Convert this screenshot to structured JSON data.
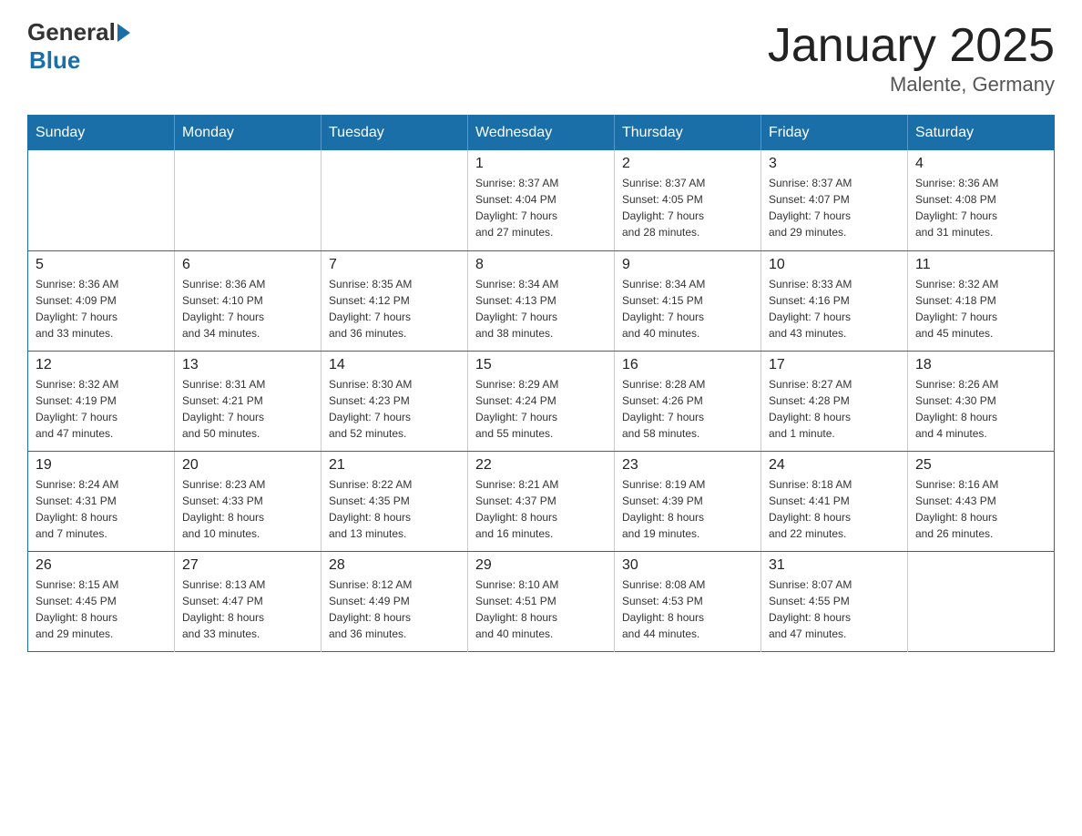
{
  "logo": {
    "general": "General",
    "blue": "Blue"
  },
  "title": "January 2025",
  "subtitle": "Malente, Germany",
  "weekdays": [
    "Sunday",
    "Monday",
    "Tuesday",
    "Wednesday",
    "Thursday",
    "Friday",
    "Saturday"
  ],
  "weeks": [
    [
      {
        "day": "",
        "info": ""
      },
      {
        "day": "",
        "info": ""
      },
      {
        "day": "",
        "info": ""
      },
      {
        "day": "1",
        "info": "Sunrise: 8:37 AM\nSunset: 4:04 PM\nDaylight: 7 hours\nand 27 minutes."
      },
      {
        "day": "2",
        "info": "Sunrise: 8:37 AM\nSunset: 4:05 PM\nDaylight: 7 hours\nand 28 minutes."
      },
      {
        "day": "3",
        "info": "Sunrise: 8:37 AM\nSunset: 4:07 PM\nDaylight: 7 hours\nand 29 minutes."
      },
      {
        "day": "4",
        "info": "Sunrise: 8:36 AM\nSunset: 4:08 PM\nDaylight: 7 hours\nand 31 minutes."
      }
    ],
    [
      {
        "day": "5",
        "info": "Sunrise: 8:36 AM\nSunset: 4:09 PM\nDaylight: 7 hours\nand 33 minutes."
      },
      {
        "day": "6",
        "info": "Sunrise: 8:36 AM\nSunset: 4:10 PM\nDaylight: 7 hours\nand 34 minutes."
      },
      {
        "day": "7",
        "info": "Sunrise: 8:35 AM\nSunset: 4:12 PM\nDaylight: 7 hours\nand 36 minutes."
      },
      {
        "day": "8",
        "info": "Sunrise: 8:34 AM\nSunset: 4:13 PM\nDaylight: 7 hours\nand 38 minutes."
      },
      {
        "day": "9",
        "info": "Sunrise: 8:34 AM\nSunset: 4:15 PM\nDaylight: 7 hours\nand 40 minutes."
      },
      {
        "day": "10",
        "info": "Sunrise: 8:33 AM\nSunset: 4:16 PM\nDaylight: 7 hours\nand 43 minutes."
      },
      {
        "day": "11",
        "info": "Sunrise: 8:32 AM\nSunset: 4:18 PM\nDaylight: 7 hours\nand 45 minutes."
      }
    ],
    [
      {
        "day": "12",
        "info": "Sunrise: 8:32 AM\nSunset: 4:19 PM\nDaylight: 7 hours\nand 47 minutes."
      },
      {
        "day": "13",
        "info": "Sunrise: 8:31 AM\nSunset: 4:21 PM\nDaylight: 7 hours\nand 50 minutes."
      },
      {
        "day": "14",
        "info": "Sunrise: 8:30 AM\nSunset: 4:23 PM\nDaylight: 7 hours\nand 52 minutes."
      },
      {
        "day": "15",
        "info": "Sunrise: 8:29 AM\nSunset: 4:24 PM\nDaylight: 7 hours\nand 55 minutes."
      },
      {
        "day": "16",
        "info": "Sunrise: 8:28 AM\nSunset: 4:26 PM\nDaylight: 7 hours\nand 58 minutes."
      },
      {
        "day": "17",
        "info": "Sunrise: 8:27 AM\nSunset: 4:28 PM\nDaylight: 8 hours\nand 1 minute."
      },
      {
        "day": "18",
        "info": "Sunrise: 8:26 AM\nSunset: 4:30 PM\nDaylight: 8 hours\nand 4 minutes."
      }
    ],
    [
      {
        "day": "19",
        "info": "Sunrise: 8:24 AM\nSunset: 4:31 PM\nDaylight: 8 hours\nand 7 minutes."
      },
      {
        "day": "20",
        "info": "Sunrise: 8:23 AM\nSunset: 4:33 PM\nDaylight: 8 hours\nand 10 minutes."
      },
      {
        "day": "21",
        "info": "Sunrise: 8:22 AM\nSunset: 4:35 PM\nDaylight: 8 hours\nand 13 minutes."
      },
      {
        "day": "22",
        "info": "Sunrise: 8:21 AM\nSunset: 4:37 PM\nDaylight: 8 hours\nand 16 minutes."
      },
      {
        "day": "23",
        "info": "Sunrise: 8:19 AM\nSunset: 4:39 PM\nDaylight: 8 hours\nand 19 minutes."
      },
      {
        "day": "24",
        "info": "Sunrise: 8:18 AM\nSunset: 4:41 PM\nDaylight: 8 hours\nand 22 minutes."
      },
      {
        "day": "25",
        "info": "Sunrise: 8:16 AM\nSunset: 4:43 PM\nDaylight: 8 hours\nand 26 minutes."
      }
    ],
    [
      {
        "day": "26",
        "info": "Sunrise: 8:15 AM\nSunset: 4:45 PM\nDaylight: 8 hours\nand 29 minutes."
      },
      {
        "day": "27",
        "info": "Sunrise: 8:13 AM\nSunset: 4:47 PM\nDaylight: 8 hours\nand 33 minutes."
      },
      {
        "day": "28",
        "info": "Sunrise: 8:12 AM\nSunset: 4:49 PM\nDaylight: 8 hours\nand 36 minutes."
      },
      {
        "day": "29",
        "info": "Sunrise: 8:10 AM\nSunset: 4:51 PM\nDaylight: 8 hours\nand 40 minutes."
      },
      {
        "day": "30",
        "info": "Sunrise: 8:08 AM\nSunset: 4:53 PM\nDaylight: 8 hours\nand 44 minutes."
      },
      {
        "day": "31",
        "info": "Sunrise: 8:07 AM\nSunset: 4:55 PM\nDaylight: 8 hours\nand 47 minutes."
      },
      {
        "day": "",
        "info": ""
      }
    ]
  ]
}
